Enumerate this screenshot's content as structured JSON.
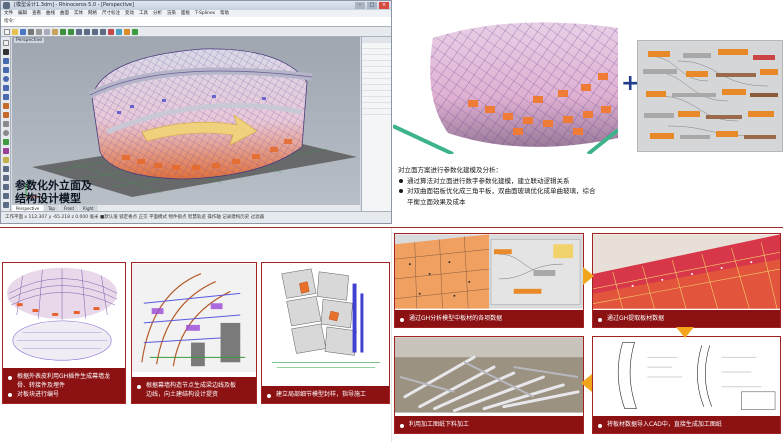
{
  "rhino": {
    "title": "[模型设计1.3dm] - Rhinoceros 5.0 - [Perspective]",
    "win_min": "–",
    "win_max": "□",
    "win_close": "×",
    "menu": [
      "文件",
      "编辑",
      "查看",
      "曲线",
      "曲面",
      "实体",
      "网格",
      "尺寸标注",
      "变动",
      "工具",
      "分析",
      "渲染",
      "面板",
      "T-Splines",
      "帮助"
    ],
    "command": "指令:",
    "viewport_label": "Perspective",
    "caption_line1": "参数化外立面及",
    "caption_line2": "结构设计模型",
    "tabs": [
      "Perspective",
      "Top",
      "Front",
      "Right"
    ],
    "status": "工作平面  x 112.307  y -65.218  z 0.000   毫米   ■默认值   锁定格点  正交  平面模式  物件锁点  智慧轨迹  操作轴  记录建构历史  过滤器"
  },
  "top_right": {
    "plus": "+",
    "heading": "对立面方案进行参数化建模及分析：",
    "bullets": [
      "通过算法对立面进行数字参数化建模，建立联动逻辑关系",
      "对双曲面铝板优化成三角平板，双曲面玻璃优化成单曲玻璃，综合平衡立面效果及成本"
    ]
  },
  "bottom_left": {
    "cards": [
      {
        "caption_lines": [
          "根据外表皮利用GH插件生成幕墙龙",
          "骨、转接件及埋件"
        ],
        "caption_extra": "对板块进行编号"
      },
      {
        "caption_lines": [
          "根据幕墙构造节点生成梁边线及板",
          "边线，向土建结构设计提资"
        ]
      },
      {
        "caption_lines": [
          "建立局部细节模型封样，指导施工"
        ]
      }
    ]
  },
  "bottom_right": {
    "cards": [
      {
        "caption": "通过GH分析模型中板材的各项数据"
      },
      {
        "caption": "通过GH提取板材数据"
      },
      {
        "caption": "利用加工图纸下料加工"
      },
      {
        "caption": "将板材数据导入CAD中，直接生成加工图纸"
      }
    ]
  },
  "colors": {
    "caption_bg": "#8b1113",
    "border": "#a32222",
    "arrow": "#f2a51a",
    "plus": "#1f3d8a"
  }
}
